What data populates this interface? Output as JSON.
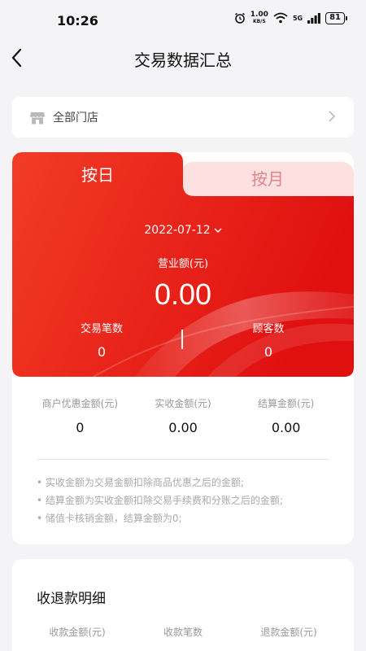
{
  "status_bar": {
    "time": "10:26",
    "net_speed_value": "1.00",
    "net_speed_unit": "KB/S",
    "signal": "5G",
    "battery": "81"
  },
  "header": {
    "title": "交易数据汇总"
  },
  "store_selector": {
    "label": "全部门店"
  },
  "tabs": {
    "day": "按日",
    "month": "按月"
  },
  "summary": {
    "date": "2022-07-12",
    "revenue_label": "营业额(元)",
    "revenue_value": "0.00",
    "transactions_label": "交易笔数",
    "transactions_value": "0",
    "customers_label": "顾客数",
    "customers_value": "0"
  },
  "metrics": [
    {
      "label": "商户优惠金额(元)",
      "value": "0"
    },
    {
      "label": "实收金额(元)",
      "value": "0.00"
    },
    {
      "label": "结算金额(元)",
      "value": "0.00"
    }
  ],
  "notes": [
    "• 实收金额为交易金额扣除商品优惠之后的金额;",
    "• 结算金额为实收金额扣除交易手续费和分账之后的金额;",
    "• 储值卡核销金额，结算金额为0;"
  ],
  "detail": {
    "title": "收退款明细",
    "columns": [
      "收款金额(元)",
      "收款笔数",
      "退款金额(元)"
    ]
  },
  "colors": {
    "brand_red": "#e8241a",
    "tab_inactive_bg": "#fde0e0",
    "tab_inactive_text": "#e2858a"
  }
}
